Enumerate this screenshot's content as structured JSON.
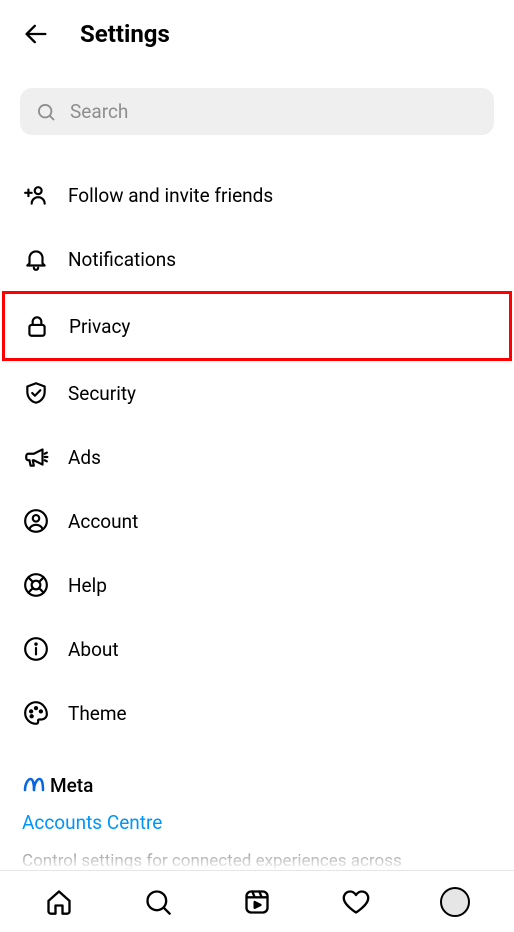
{
  "header": {
    "title": "Settings"
  },
  "search": {
    "placeholder": "Search"
  },
  "menu": {
    "follow": "Follow and invite friends",
    "notifications": "Notifications",
    "privacy": "Privacy",
    "security": "Security",
    "ads": "Ads",
    "account": "Account",
    "help": "Help",
    "about": "About",
    "theme": "Theme"
  },
  "meta": {
    "brand": "Meta",
    "link": "Accounts Centre",
    "description": "Control settings for connected experiences across"
  }
}
